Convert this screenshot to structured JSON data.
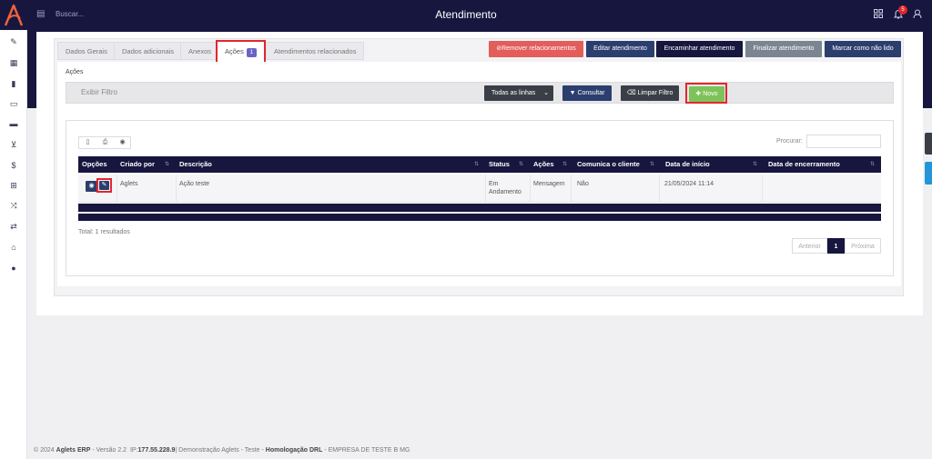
{
  "header": {
    "title": "Atendimento",
    "search_placeholder": "Buscar...",
    "notification_count": "5"
  },
  "tabs": [
    {
      "label": "Dados Gerais"
    },
    {
      "label": "Dados adicionais"
    },
    {
      "label": "Anexos"
    },
    {
      "label": "Ações",
      "badge": "1"
    },
    {
      "label": "Atendimentos relacionados"
    }
  ],
  "actions": {
    "remover": "Remover relacionamentos",
    "editar": "Editar atendimento",
    "encaminhar": "Encaminhar atendimento",
    "finalizar": "Finalizar atendimento",
    "marcar": "Marcar como não lido"
  },
  "section": {
    "title": "Ações",
    "filter_toggle": "Exibir Filtro",
    "select_value": "Todas as linhas",
    "consultar": "Consultar",
    "limpar": "Limpar Filtro",
    "novo": "Novo"
  },
  "table": {
    "search_label": "Procurar:",
    "columns": [
      "Opções",
      "Criado por",
      "Descrição",
      "Status",
      "Ações",
      "Comunica o cliente",
      "Data de início",
      "Data de encerramento"
    ],
    "rows": [
      {
        "criado_por": "Aglets",
        "descricao": "Ação teste",
        "status_line1": "Em",
        "status_line2": "Andamento",
        "acoes": "Mensagem",
        "comunica": "Não",
        "data_inicio": "21/05/2024 11:14",
        "data_encerramento": ""
      }
    ],
    "total": "Total: 1 resultados",
    "pager": {
      "prev": "Anterior",
      "page": "1",
      "next": "Próxima"
    }
  },
  "footer": {
    "copyright": "© 2024",
    "product": "Aglets ERP",
    "version": "- Versão 2.2",
    "ip_label": "IP:",
    "ip": "177.55.228.9",
    "demo": "| Demonstração Aglets - Teste -",
    "env": "Homologação DRL",
    "company": "- EMPRESA DE TESTE B MG"
  },
  "colors": {
    "navy": "#17163f",
    "danger": "#e35d5b",
    "primary": "#2c3e6e",
    "success": "#7ec35a",
    "highlight": "#e3262d"
  }
}
